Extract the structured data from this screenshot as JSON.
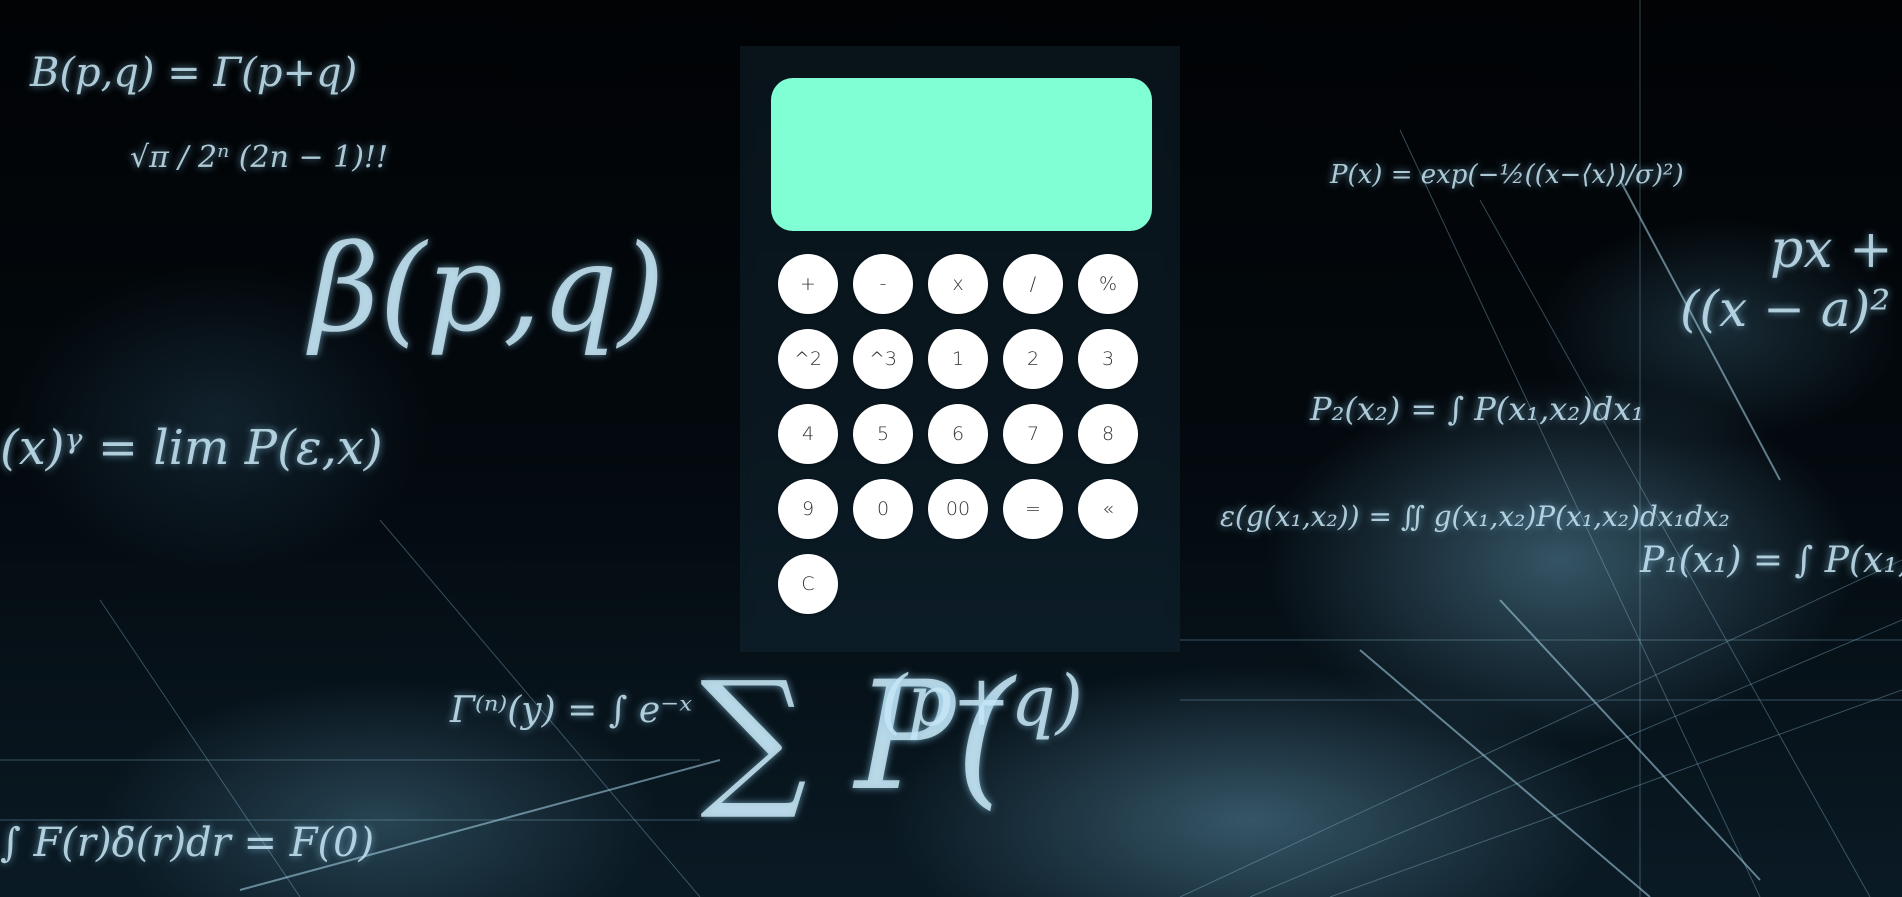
{
  "calculator": {
    "display_value": "",
    "display_color": "#80ffd4",
    "key_color": "#ffffff",
    "keys": [
      {
        "label": "+",
        "name": "add-button"
      },
      {
        "label": "-",
        "name": "subtract-button"
      },
      {
        "label": "x",
        "name": "multiply-button"
      },
      {
        "label": "/",
        "name": "divide-button"
      },
      {
        "label": "%",
        "name": "percent-button"
      },
      {
        "label": "^2",
        "name": "square-button"
      },
      {
        "label": "^3",
        "name": "cube-button"
      },
      {
        "label": "1",
        "name": "digit-1-button"
      },
      {
        "label": "2",
        "name": "digit-2-button"
      },
      {
        "label": "3",
        "name": "digit-3-button"
      },
      {
        "label": "4",
        "name": "digit-4-button"
      },
      {
        "label": "5",
        "name": "digit-5-button"
      },
      {
        "label": "6",
        "name": "digit-6-button"
      },
      {
        "label": "7",
        "name": "digit-7-button"
      },
      {
        "label": "8",
        "name": "digit-8-button"
      },
      {
        "label": "9",
        "name": "digit-9-button"
      },
      {
        "label": "0",
        "name": "digit-0-button"
      },
      {
        "label": "00",
        "name": "double-zero-button"
      },
      {
        "label": "=",
        "name": "equals-button"
      },
      {
        "label": "«",
        "name": "backspace-button"
      },
      {
        "label": "C",
        "name": "clear-button"
      }
    ]
  }
}
